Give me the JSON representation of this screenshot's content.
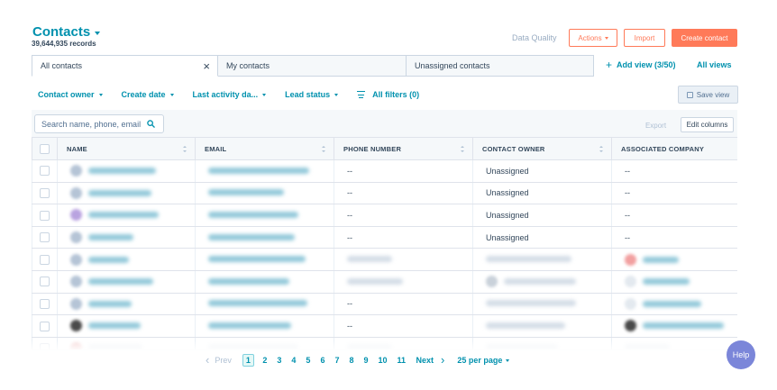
{
  "header": {
    "title": "Contacts",
    "record_count": "39,644,935 records",
    "data_quality": "Data Quality",
    "actions_label": "Actions",
    "import_label": "Import",
    "create_label": "Create contact"
  },
  "tabs": [
    {
      "label": "All contacts",
      "active": true
    },
    {
      "label": "My contacts",
      "active": false
    },
    {
      "label": "Unassigned contacts",
      "active": false
    }
  ],
  "views": {
    "add_view_label": "Add view (3/50)",
    "all_views_label": "All views"
  },
  "filters": {
    "items": [
      "Contact owner",
      "Create date",
      "Last activity da...",
      "Lead status"
    ],
    "all_filters_label": "All filters (0)",
    "save_view_label": "Save view"
  },
  "toolbar": {
    "search_placeholder": "Search name, phone, email",
    "export_label": "Export",
    "edit_columns_label": "Edit columns"
  },
  "table": {
    "columns": [
      "NAME",
      "EMAIL",
      "PHONE NUMBER",
      "CONTACT OWNER",
      "ASSOCIATED COMPANY"
    ],
    "rows": [
      {
        "phone": "--",
        "owner": "Unassigned",
        "company": "--"
      },
      {
        "phone": "--",
        "owner": "Unassigned",
        "company": "--"
      },
      {
        "phone": "--",
        "owner": "Unassigned",
        "company": "--"
      },
      {
        "phone": "--",
        "owner": "Unassigned",
        "company": "--"
      },
      {
        "phone": "",
        "owner": "",
        "company": ""
      },
      {
        "phone": "",
        "owner": "",
        "company": ""
      },
      {
        "phone": "--",
        "owner": "",
        "company": ""
      },
      {
        "phone": "--",
        "owner": "",
        "company": ""
      }
    ]
  },
  "pagination": {
    "prev_label": "Prev",
    "pages": [
      "1",
      "2",
      "3",
      "4",
      "5",
      "6",
      "7",
      "8",
      "9",
      "10",
      "11"
    ],
    "current_page": "1",
    "next_label": "Next",
    "per_page_label": "25 per page"
  },
  "help": {
    "label": "Help"
  },
  "colors": {
    "accent": "#0091ae",
    "primary_button": "#ff7a59",
    "help_bubble": "#7b86d9"
  }
}
